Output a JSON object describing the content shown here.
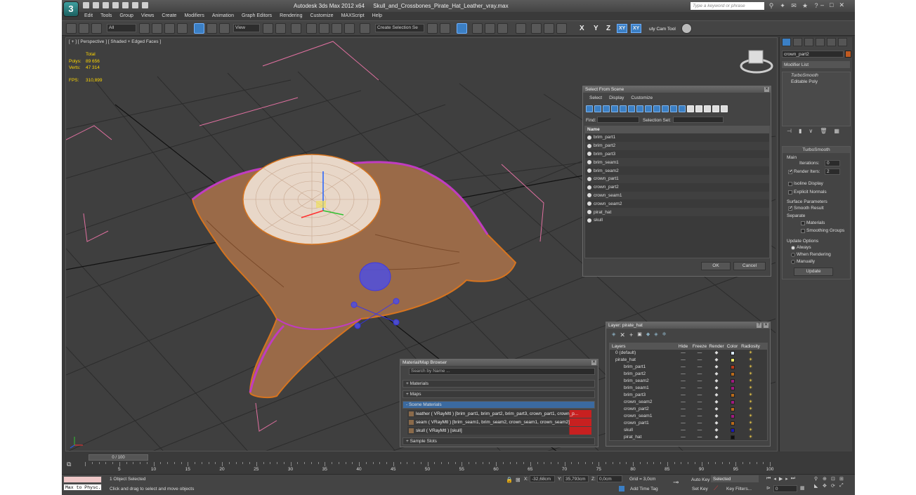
{
  "app": {
    "title": "Autodesk 3ds Max  2012 x64",
    "file": "Skull_and_Crossbones_Pirate_Hat_Leather_vray.max",
    "logo": "3",
    "search_placeholder": "Type a keyword or phrase"
  },
  "menu": [
    "Edit",
    "Tools",
    "Group",
    "Views",
    "Create",
    "Modifiers",
    "Animation",
    "Graph Editors",
    "Rendering",
    "Customize",
    "MAXScript",
    "Help"
  ],
  "toolbar": {
    "filter": "All",
    "refcoord": "View",
    "selset": "Create Selection Se",
    "axes": [
      "X",
      "Y",
      "Z",
      "XY",
      "XY"
    ],
    "cam_tool": "uty Cam Tool"
  },
  "viewport": {
    "label": "[ + ] [ Perspective ] [ Shaded + Edged Faces ]",
    "stats": {
      "header": "Total",
      "polys_label": "Polys:",
      "polys": "89 656",
      "verts_label": "Verts:",
      "verts": "47 314",
      "fps_label": "FPS:",
      "fps": "310,899"
    }
  },
  "command_panel": {
    "object_name": "crown_part2",
    "modifier_list": "Modifier List",
    "stack": [
      "TurboSmooth",
      "Editable Poly"
    ],
    "rollout_title": "TurboSmooth",
    "main_label": "Main",
    "iterations_label": "Iterations:",
    "iterations": "0",
    "render_iters_label": "Render Iters:",
    "render_iters": "2",
    "isoline": "Isoline Display",
    "explicit_normals": "Explicit Normals",
    "surface_params": "Surface Parameters",
    "smooth_result": "Smooth Result",
    "separate": "Separate",
    "materials": "Materials",
    "smoothing_groups": "Smoothing Groups",
    "update_options": "Update Options",
    "always": "Always",
    "when_rendering": "When Rendering",
    "manually": "Manually",
    "update_btn": "Update"
  },
  "select_from_scene": {
    "title": "Select From Scene",
    "menu": [
      "Select",
      "Display",
      "Customize"
    ],
    "find_label": "Find:",
    "selset_label": "Selection Set:",
    "col_name": "Name",
    "items": [
      "brim_part1",
      "brim_part2",
      "brim_part3",
      "brim_seam1",
      "brim_seam2",
      "crown_part1",
      "crown_part2",
      "crown_seam1",
      "crown_seam2",
      "pirat_hat",
      "skull"
    ],
    "ok": "OK",
    "cancel": "Cancel"
  },
  "layers": {
    "title": "Layer: pirate_hat",
    "help": "?",
    "toolbar_icons": [
      "create-layer-icon",
      "delete-layer-icon",
      "add-selection-icon",
      "select-objects-icon",
      "highlight-icon",
      "hide-all-icon",
      "freeze-all-icon"
    ],
    "columns": [
      "Layers",
      "Hide",
      "Freeze",
      "Render",
      "Color",
      "Radiosity"
    ],
    "rows": [
      {
        "name": "0 (default)",
        "color": "#d8e8ff",
        "indent": 0
      },
      {
        "name": "pirate_hat",
        "color": "#e8e868",
        "indent": 0
      },
      {
        "name": "brim_part1",
        "color": "#b83c1a",
        "indent": 1
      },
      {
        "name": "brim_part2",
        "color": "#b86a1a",
        "indent": 1
      },
      {
        "name": "brim_seam2",
        "color": "#a01a80",
        "indent": 1
      },
      {
        "name": "brim_seam1",
        "color": "#a01a80",
        "indent": 1
      },
      {
        "name": "brim_part3",
        "color": "#b86a1a",
        "indent": 1
      },
      {
        "name": "crown_seam2",
        "color": "#a01a80",
        "indent": 1
      },
      {
        "name": "crown_part2",
        "color": "#b86a1a",
        "indent": 1
      },
      {
        "name": "crown_seam1",
        "color": "#a01a80",
        "indent": 1
      },
      {
        "name": "crown_part1",
        "color": "#b86a1a",
        "indent": 1
      },
      {
        "name": "skull",
        "color": "#1a1ab8",
        "indent": 1
      },
      {
        "name": "pirat_hat",
        "color": "#111111",
        "indent": 1
      }
    ]
  },
  "material_browser": {
    "title": "Material/Map Browser",
    "search": "Search by Name ...",
    "sections": [
      "+ Materials",
      "+ Maps",
      "- Scene Materials",
      "+ Sample Slots"
    ],
    "items": [
      "leather  ( VRayMtl ) [brim_part1, brim_part2, brim_part3, crown_part1, crown_p...",
      "seam  ( VRayMtl ) [brim_seam1, brim_seam2, crown_seam1, crown_seam2]",
      "skull  ( VRayMtl ) [skull]"
    ]
  },
  "timeline": {
    "slider": "0 / 100",
    "ticks": [
      5,
      10,
      15,
      20,
      25,
      30,
      35,
      40,
      45,
      50,
      55,
      60,
      65,
      70,
      75,
      80,
      85,
      90,
      95,
      100
    ]
  },
  "status": {
    "maxscript": "Max to Physc.",
    "selected": "1 Object Selected",
    "prompt": "Click and drag to select and move objects",
    "x_label": "X:",
    "x": "-32,68cm",
    "y_label": "Y:",
    "y": "35,793cm",
    "z_label": "Z:",
    "z": "0,0cm",
    "grid": "Grid = 3,0cm",
    "add_time_tag": "Add Time Tag",
    "auto_key": "Auto Key",
    "set_key": "Set Key",
    "key_mode": "Selected",
    "key_filters": "Key Filters...",
    "frame": "0"
  }
}
